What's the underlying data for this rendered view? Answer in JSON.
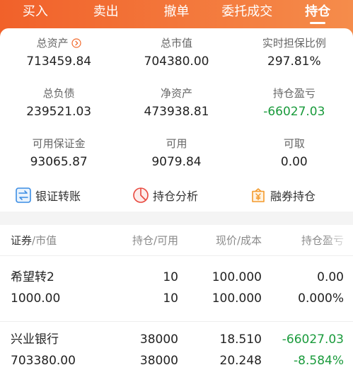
{
  "tabs": [
    {
      "label": "买入"
    },
    {
      "label": "卖出"
    },
    {
      "label": "撤单"
    },
    {
      "label": "委托成交"
    },
    {
      "label": "持仓",
      "active": true
    }
  ],
  "summary": {
    "total_assets": {
      "label": "总资产",
      "value": "713459.84"
    },
    "total_market_value": {
      "label": "总市值",
      "value": "704380.00"
    },
    "collateral_ratio": {
      "label": "实时担保比例",
      "value": "297.81%"
    },
    "total_liabilities": {
      "label": "总负债",
      "value": "239521.03"
    },
    "net_assets": {
      "label": "净资产",
      "value": "473938.81"
    },
    "position_pnl": {
      "label": "持仓盈亏",
      "value": "-66027.03",
      "tone": "loss"
    },
    "available_margin": {
      "label": "可用保证金",
      "value": "93065.87"
    },
    "available": {
      "label": "可用",
      "value": "9079.84"
    },
    "withdrawable": {
      "label": "可取",
      "value": "0.00"
    }
  },
  "actions": [
    {
      "label": "银证转账",
      "icon": "bank-transfer-icon"
    },
    {
      "label": "持仓分析",
      "icon": "pie-chart-icon"
    },
    {
      "label": "融券持仓",
      "icon": "yen-bag-icon"
    }
  ],
  "holdings": {
    "headers": {
      "security": "证券",
      "market_value": "/市值",
      "position_available": "持仓/可用",
      "price_cost": "现价/成本",
      "pnl": "持仓盈亏"
    },
    "rows": [
      {
        "name": "希望转2",
        "market_value": "1000.00",
        "position": "10",
        "available": "10",
        "price": "100.000",
        "cost": "100.000",
        "pnl": "0.00",
        "pnl_pct": "0.000%",
        "tone": "flat"
      },
      {
        "name": "兴业银行",
        "market_value": "703380.00",
        "position": "38000",
        "available": "38000",
        "price": "18.510",
        "cost": "20.248",
        "pnl": "-66027.03",
        "pnl_pct": "-8.584%",
        "tone": "loss"
      }
    ]
  },
  "colors": {
    "brand": "#f26a2d",
    "loss": "#1a9b3c",
    "text": "#222222",
    "muted": "#8a8a8a"
  }
}
